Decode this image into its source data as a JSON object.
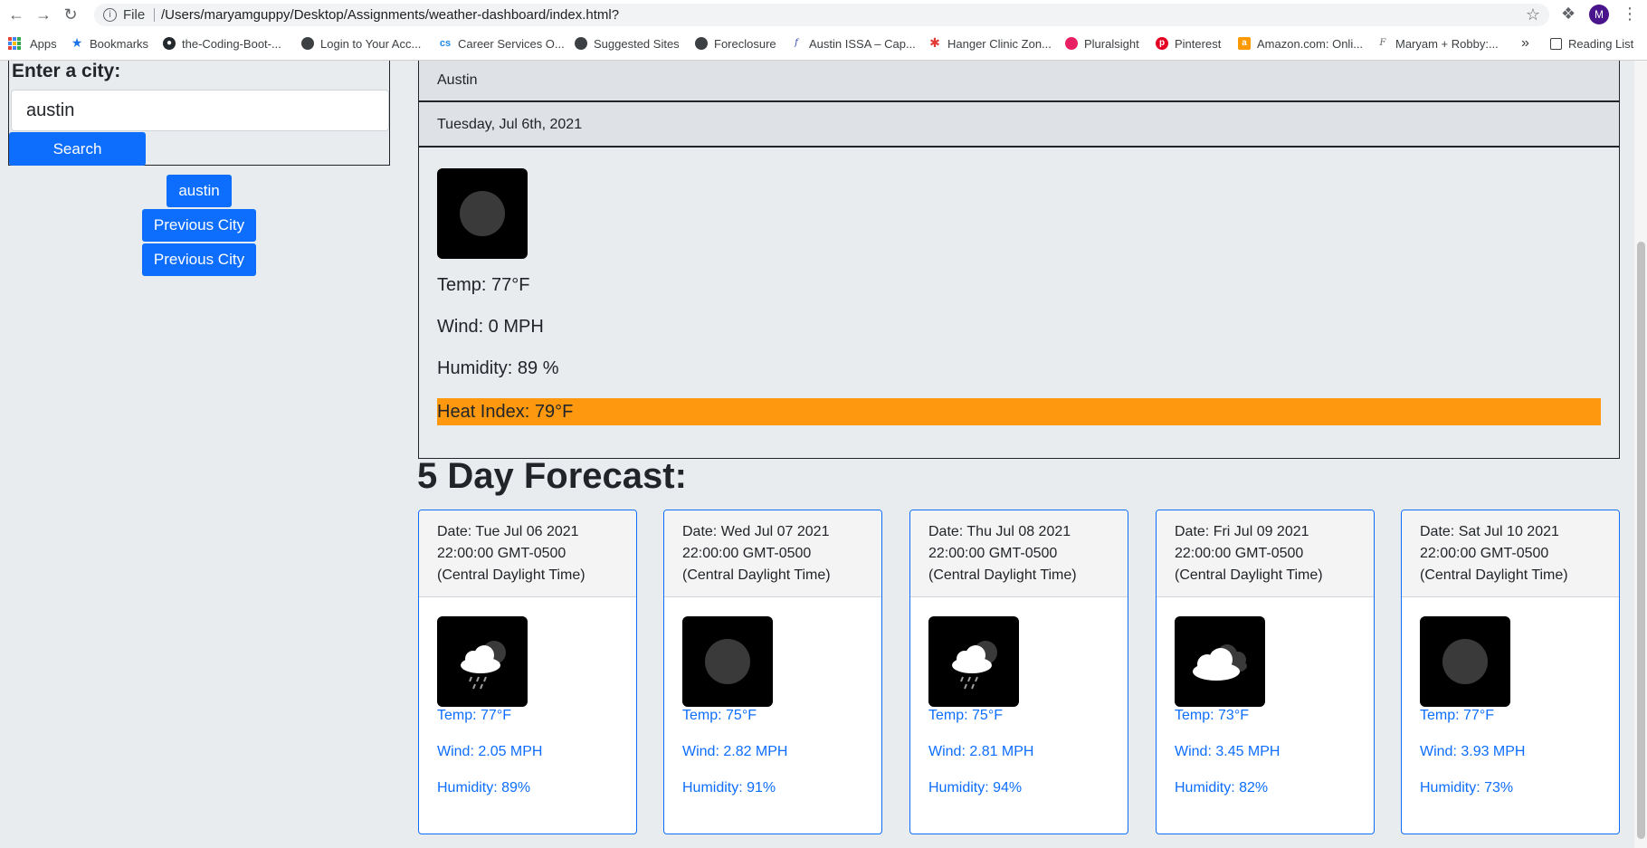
{
  "browser": {
    "file_label": "File",
    "url": "/Users/maryamguppy/Desktop/Assignments/weather-dashboard/index.html?",
    "profile_initial": "M",
    "bookmarks": [
      {
        "label": "Apps"
      },
      {
        "label": "Bookmarks"
      },
      {
        "label": "the-Coding-Boot-..."
      },
      {
        "label": "Login to Your Acc..."
      },
      {
        "label": "Career Services O..."
      },
      {
        "label": "Suggested Sites"
      },
      {
        "label": "Foreclosure"
      },
      {
        "label": "Austin ISSA – Cap..."
      },
      {
        "label": "Hanger Clinic Zon..."
      },
      {
        "label": "Pluralsight"
      },
      {
        "label": "Pinterest"
      },
      {
        "label": "Amazon.com: Onli..."
      },
      {
        "label": "Maryam + Robby:..."
      }
    ],
    "overflow_label": "»",
    "reading_list": "Reading List"
  },
  "search": {
    "label": "Enter a city:",
    "value": "austin",
    "button": "Search"
  },
  "history": [
    "austin",
    "Previous City",
    "Previous City"
  ],
  "current": {
    "city": "Austin",
    "date": "Tuesday, Jul 6th, 2021",
    "icon": "clear-night-icon",
    "temp": "Temp: 77°F",
    "wind": "Wind: 0 MPH",
    "humidity": "Humidity: 89 %",
    "heat_index": "Heat Index: 79°F",
    "heat_color": "#fd980f"
  },
  "forecast": {
    "title": "5 Day Forecast:",
    "days": [
      {
        "date_line1": "Date: Tue Jul 06 2021",
        "date_line2": "22:00:00 GMT-0500",
        "date_line3": "(Central Daylight Time)",
        "icon": "rain-night-icon",
        "temp": "Temp: 77°F",
        "wind": "Wind: 2.05 MPH",
        "humidity": "Humidity: 89%"
      },
      {
        "date_line1": "Date: Wed Jul 07 2021",
        "date_line2": "22:00:00 GMT-0500",
        "date_line3": "(Central Daylight Time)",
        "icon": "clear-night-icon",
        "temp": "Temp: 75°F",
        "wind": "Wind: 2.82 MPH",
        "humidity": "Humidity: 91%"
      },
      {
        "date_line1": "Date: Thu Jul 08 2021",
        "date_line2": "22:00:00 GMT-0500",
        "date_line3": "(Central Daylight Time)",
        "icon": "rain-night-icon",
        "temp": "Temp: 75°F",
        "wind": "Wind: 2.81 MPH",
        "humidity": "Humidity: 94%"
      },
      {
        "date_line1": "Date: Fri Jul 09 2021",
        "date_line2": "22:00:00 GMT-0500",
        "date_line3": "(Central Daylight Time)",
        "icon": "cloudy-icon",
        "temp": "Temp: 73°F",
        "wind": "Wind: 3.45 MPH",
        "humidity": "Humidity: 82%"
      },
      {
        "date_line1": "Date: Sat Jul 10 2021",
        "date_line2": "22:00:00 GMT-0500",
        "date_line3": "(Central Daylight Time)",
        "icon": "clear-night-icon",
        "temp": "Temp: 77°F",
        "wind": "Wind: 3.93 MPH",
        "humidity": "Humidity: 73%"
      }
    ]
  },
  "colors": {
    "accent": "#0d6efd",
    "page_bg": "#e9ecef",
    "header_bg": "#dee2e6"
  }
}
